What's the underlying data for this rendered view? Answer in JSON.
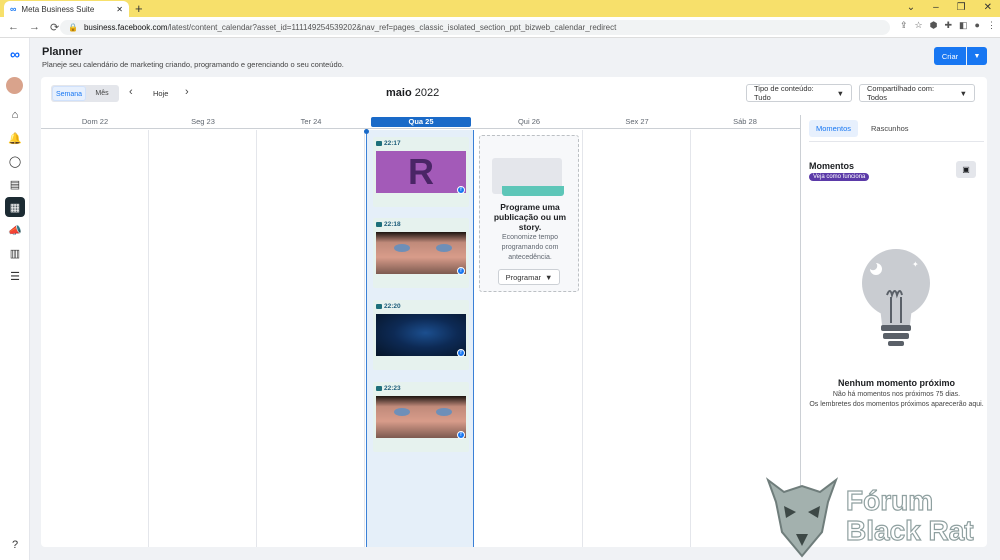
{
  "browser": {
    "tab_title": "Meta Business Suite",
    "new_tab": "+",
    "url_host": "business.facebook.com",
    "url_path": "/latest/content_calendar?asset_id=111149254539202&nav_ref=pages_classic_isolated_section_ppt_bizweb_calendar_redirect"
  },
  "header": {
    "title": "Planner",
    "subtitle": "Planeje seu calendário de marketing criando, programando e gerenciando o seu conteúdo.",
    "create_label": "Criar"
  },
  "toolbar": {
    "week_label": "Semana",
    "month_label": "Mês",
    "today_label": "Hoje",
    "month_name": "maio",
    "year": "2022",
    "content_type_filter": "Tipo de conteúdo: Tudo",
    "shared_with_filter": "Compartilhado com: Todos"
  },
  "days": [
    {
      "label": "Dom 22"
    },
    {
      "label": "Seg 23"
    },
    {
      "label": "Ter 24"
    },
    {
      "label": "Qua 25"
    },
    {
      "label": "Qui 26"
    },
    {
      "label": "Sex 27"
    },
    {
      "label": "Sáb 28"
    }
  ],
  "posts": [
    {
      "time": "22:17",
      "thumb": "purple-r"
    },
    {
      "time": "22:18",
      "thumb": "face"
    },
    {
      "time": "22:20",
      "thumb": "blue-particles"
    },
    {
      "time": "22:23",
      "thumb": "face"
    }
  ],
  "thumb_letter": "R",
  "schedule_card": {
    "title": "Programe uma publicação ou um story.",
    "description": "Economize tempo programando com antecedência.",
    "button_label": "Programar"
  },
  "side_panel": {
    "tab_moments": "Momentos",
    "tab_drafts": "Rascunhos",
    "heading": "Momentos",
    "how_it_works": "Veja como funciona",
    "empty_title": "Nenhum momento próximo",
    "empty_line1": "Não há momentos nos próximos 75 dias.",
    "empty_line2": "Os lembretes dos momentos próximos aparecerão aqui."
  },
  "watermark": {
    "line1": "Fórum",
    "line2": "Black Rat"
  },
  "colors": {
    "accent": "#1877f2",
    "today_header": "#1a6ac8",
    "post_bg": "#e6f2ee",
    "pill": "#5b3aa8"
  }
}
